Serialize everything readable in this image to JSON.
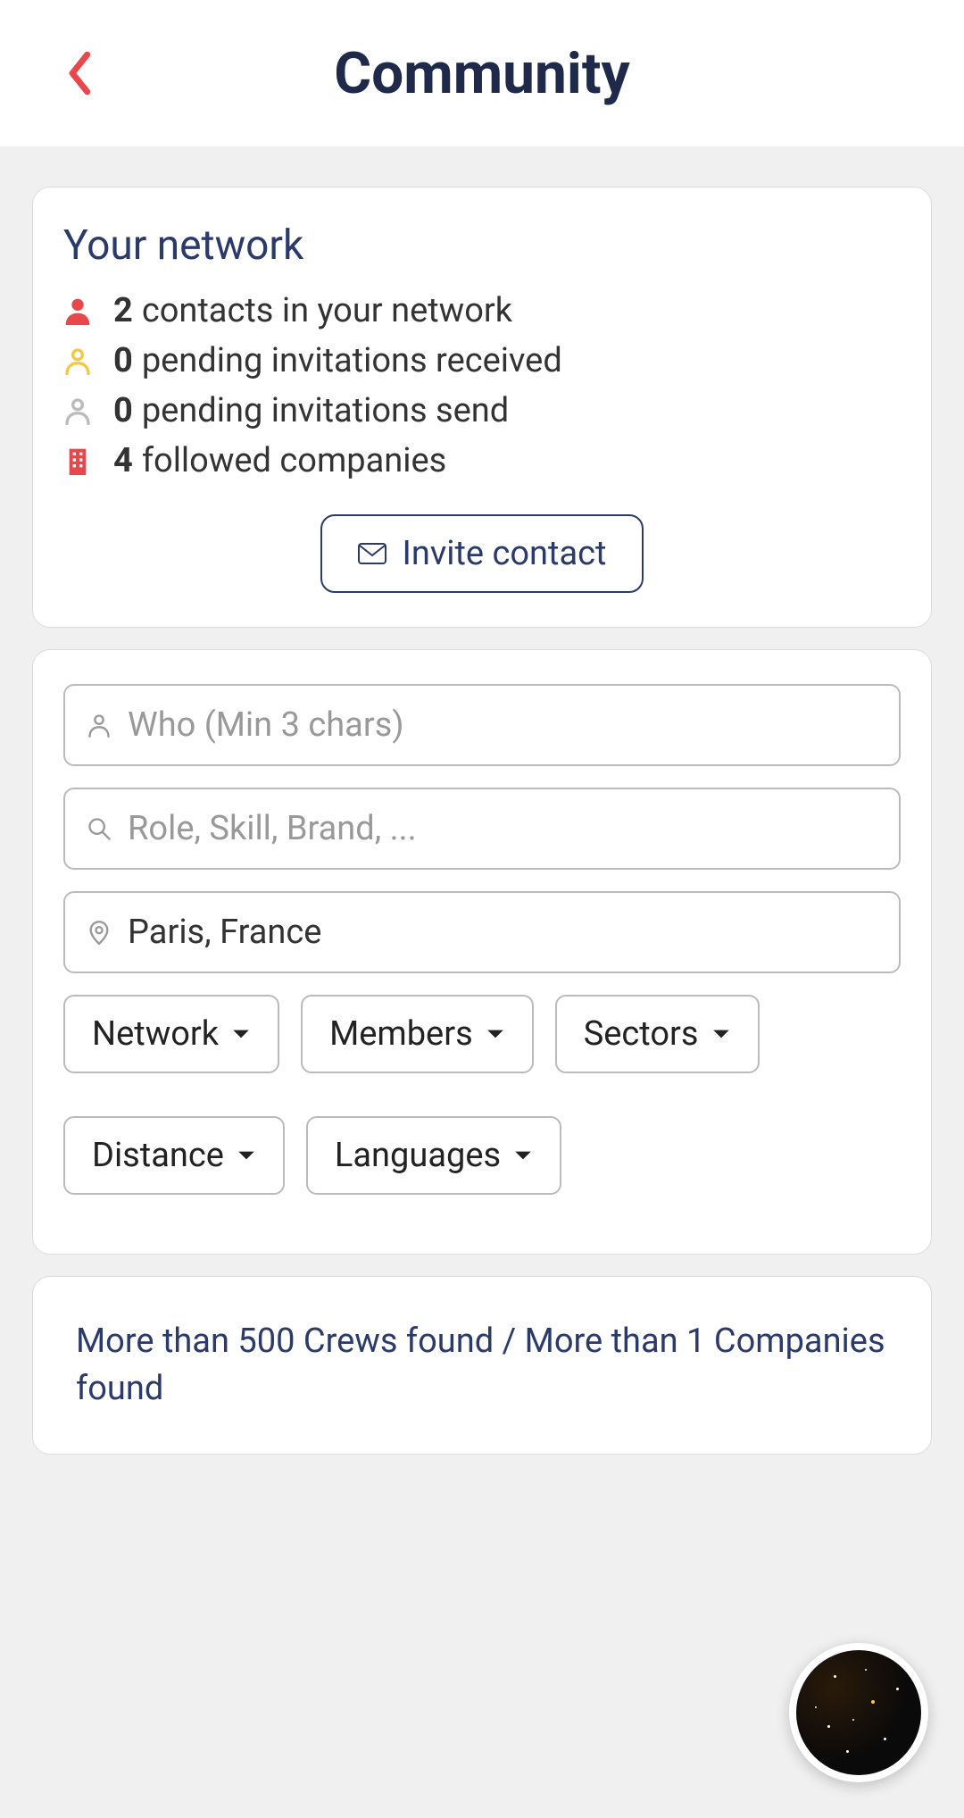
{
  "header": {
    "title": "Community"
  },
  "network": {
    "title": "Your network",
    "stats": [
      {
        "count": "2",
        "label": "contacts in your network"
      },
      {
        "count": "0",
        "label": "pending invitations received"
      },
      {
        "count": "0",
        "label": "pending invitations send"
      },
      {
        "count": "4",
        "label": "followed companies"
      }
    ],
    "invite_label": "Invite contact"
  },
  "search": {
    "who_placeholder": "Who (Min 3 chars)",
    "what_placeholder": "Role, Skill, Brand, ...",
    "location_value": "Paris, France",
    "filters": [
      "Network",
      "Members",
      "Sectors",
      "Distance",
      "Languages"
    ]
  },
  "results": {
    "text": "More than 500 Crews found / More than 1 Companies found"
  }
}
